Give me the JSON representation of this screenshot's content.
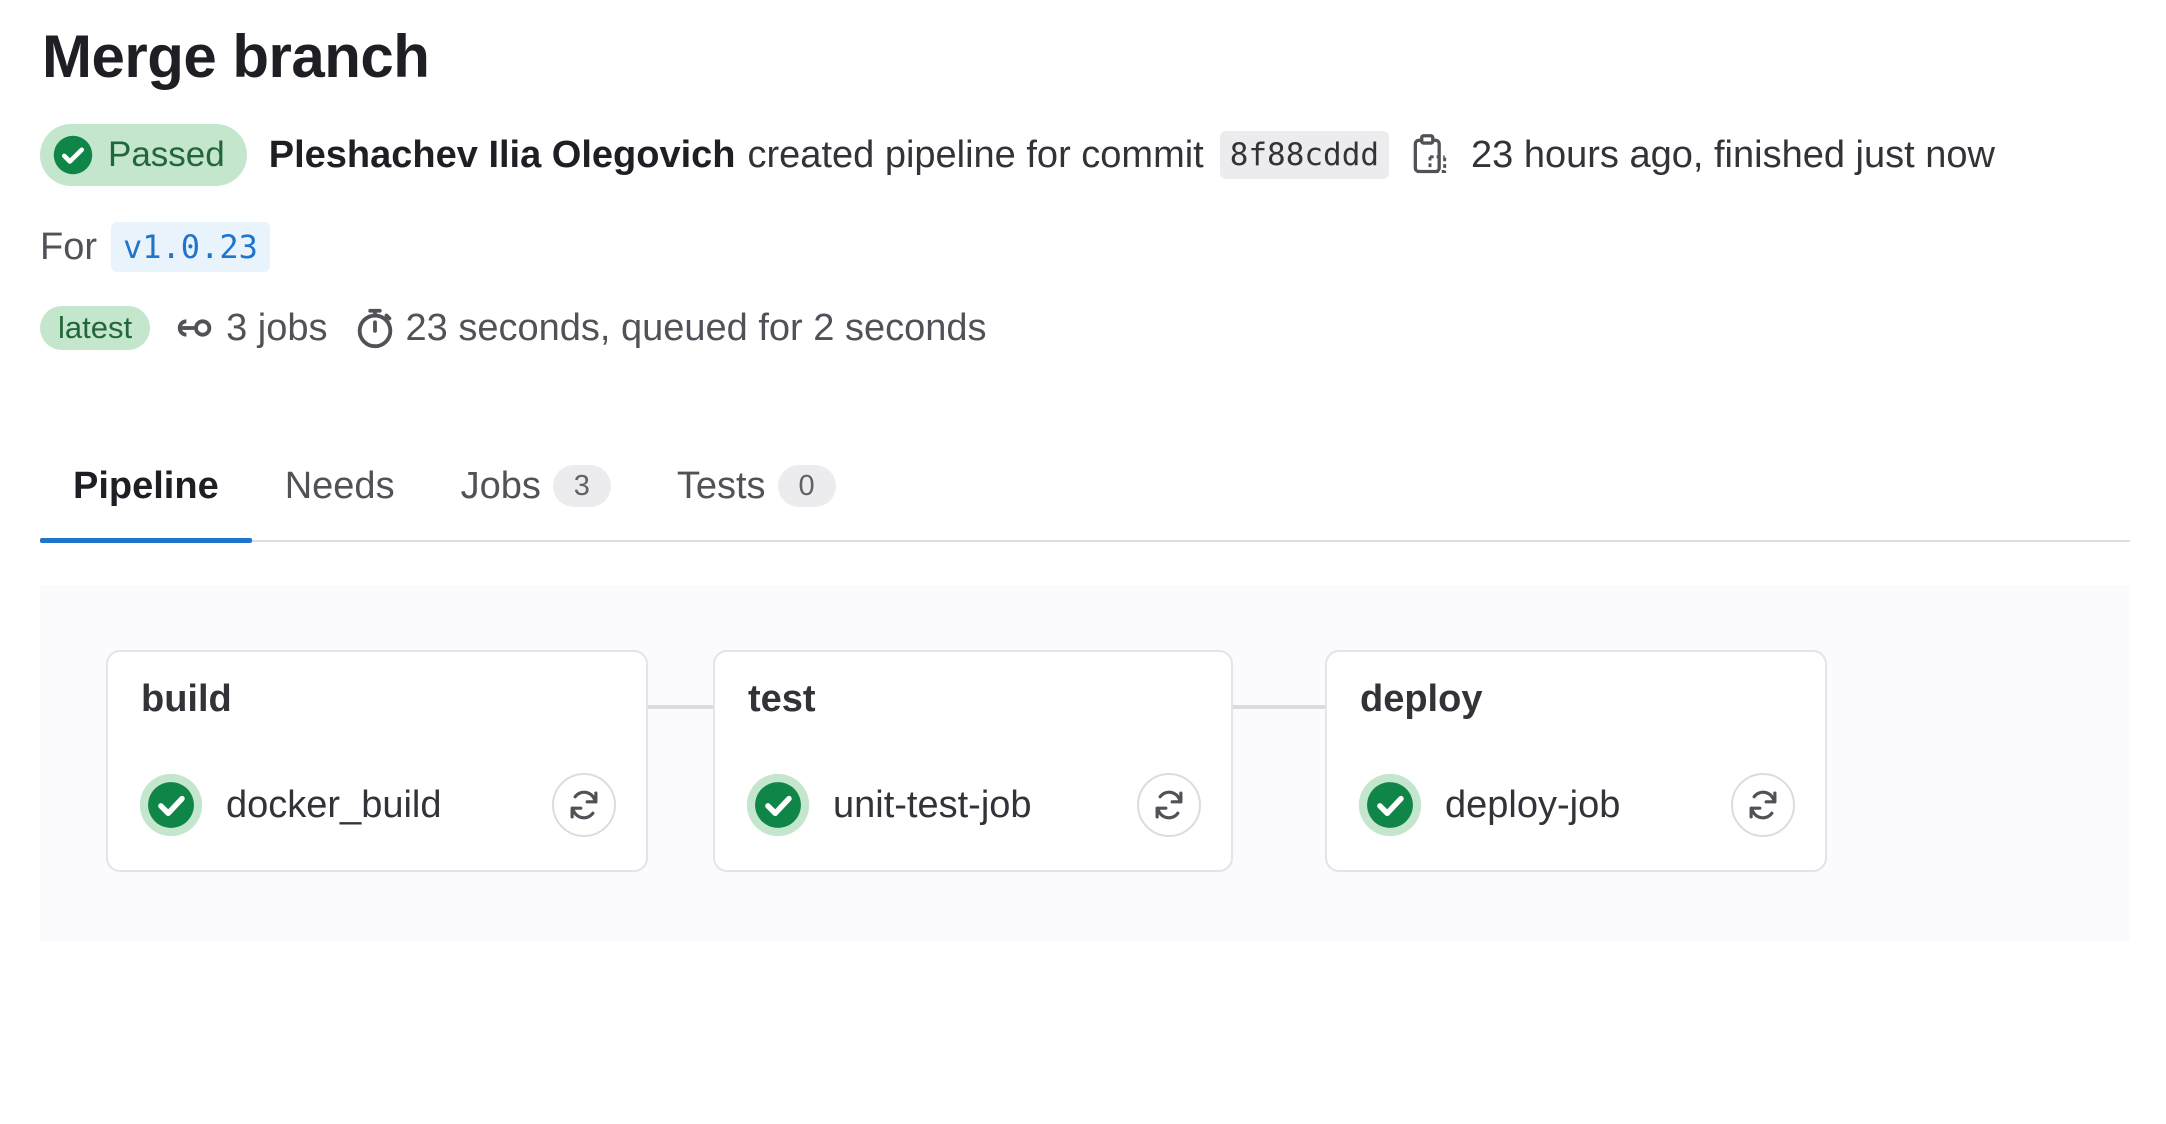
{
  "header": {
    "title": "Merge branch",
    "status_label": "Passed",
    "author": "Pleshachev Ilia Olegovich",
    "action_text": "created pipeline for commit",
    "commit_sha": "8f88cddd",
    "timing_text": "23 hours ago, finished just now",
    "for_label": "For",
    "ref": "v1.0.23",
    "latest_label": "latest",
    "jobs_text": "3 jobs",
    "duration_text": "23 seconds, queued for 2 seconds"
  },
  "tabs": [
    {
      "label": "Pipeline",
      "active": true
    },
    {
      "label": "Needs"
    },
    {
      "label": "Jobs",
      "count": "3"
    },
    {
      "label": "Tests",
      "count": "0"
    }
  ],
  "stages": [
    {
      "name": "build",
      "job": "docker_build",
      "status": "success"
    },
    {
      "name": "test",
      "job": "unit-test-job",
      "status": "success"
    },
    {
      "name": "deploy",
      "job": "deploy-job",
      "status": "success"
    }
  ],
  "colors": {
    "success": "#108548",
    "success_bg": "#c3e6cd",
    "accent": "#1f75cb"
  },
  "icons": {
    "status": "check-circle-icon",
    "copy": "clipboard-icon",
    "jobs": "pipeline-icon",
    "duration": "timer-icon",
    "retry": "retry-icon"
  }
}
